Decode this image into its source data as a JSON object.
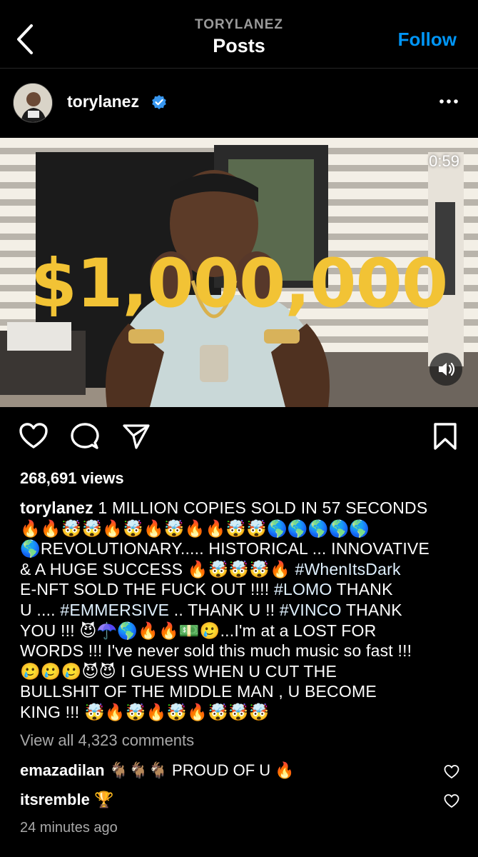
{
  "header": {
    "back_icon": "chevron-left-icon",
    "account": "TORYLANEZ",
    "title": "Posts",
    "follow_label": "Follow"
  },
  "post": {
    "username": "torylanez",
    "verified_icon": "verified-badge-icon",
    "more_icon": "more-horizontal-icon",
    "video": {
      "duration": "0:59",
      "overlay_text": "$1,000,000",
      "mute_icon": "speaker-icon",
      "overlay_color": "#f2c335"
    },
    "actions": {
      "like_icon": "heart-icon",
      "comment_icon": "comment-icon",
      "share_icon": "send-icon",
      "save_icon": "bookmark-icon"
    },
    "views": "268,691 views",
    "caption": {
      "username": "torylanez",
      "line1": "1 MILLION COPIES SOLD IN 57 SECONDS",
      "line2": "🔥🔥🤯🤯🔥🤯🔥🤯🔥🔥🤯🤯🌎🌎🌎🌎🌎",
      "line3": "🌎REVOLUTIONARY..... HISTORICAL ... INNOVATIVE",
      "line4a": "& A HUGE SUCCESS 🔥🤯🤯🤯🔥 ",
      "line4b": "#WhenItsDark",
      "line5a": "E-NFT SOLD THE FUCK OUT !!!! ",
      "line5b": "#LOMO",
      "line5c": " THANK",
      "line6a": "U .... ",
      "line6b": "#EMMERSIVE",
      "line6c": " .. THANK U !! ",
      "line6d": "#VINCO",
      "line6e": " THANK",
      "line7": "YOU !!! 😈☂️🌎🔥🔥💵🥲...I'm at a LOST FOR",
      "line8": "WORDS !!! I've never sold this much music so fast !!!",
      "line9": "🥲🥲🥲😈😈 I GUESS WHEN U CUT THE",
      "line10": "BULLSHIT OF THE MIDDLE MAN , U BECOME",
      "line11": "KING !!! 🤯🔥🤯🔥🤯🔥🤯🤯🤯"
    },
    "view_all_comments": "View all 4,323 comments",
    "comments": [
      {
        "username": "emazadilan",
        "text": "🐐🐐🐐 PROUD OF U 🔥",
        "like_icon": "heart-outline-icon"
      },
      {
        "username": "itsremble",
        "text": "🏆",
        "like_icon": "heart-outline-icon"
      }
    ],
    "timestamp": "24 minutes ago"
  }
}
